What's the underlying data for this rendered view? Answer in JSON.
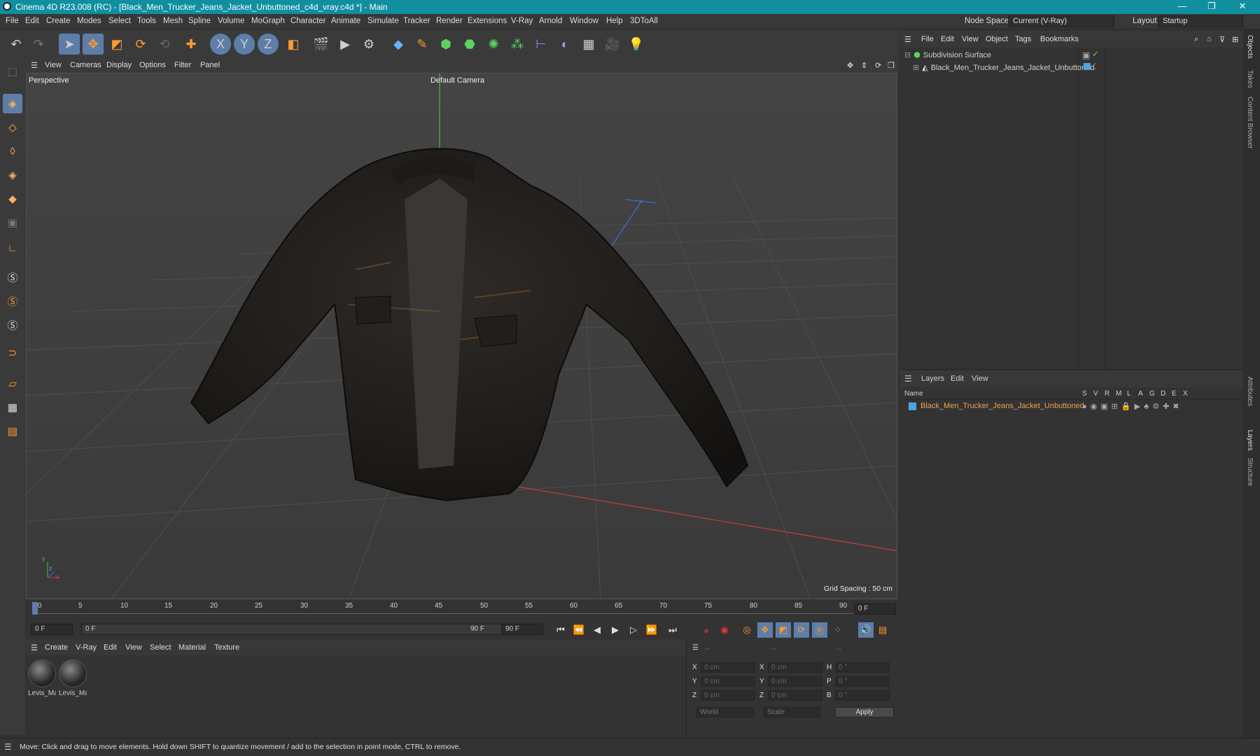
{
  "window": {
    "title": "Cinema 4D R23.008 (RC) - [Black_Men_Trucker_Jeans_Jacket_Unbuttoned_c4d_vray.c4d *] - Main",
    "minimize": "—",
    "restore": "❐",
    "close": "✕"
  },
  "menubar": {
    "items": [
      "File",
      "Edit",
      "Create",
      "Modes",
      "Select",
      "Tools",
      "Mesh",
      "Spline",
      "Volume",
      "MoGraph",
      "Character",
      "Animate",
      "Simulate",
      "Tracker",
      "Render",
      "Extensions",
      "V-Ray",
      "Arnold",
      "Window",
      "Help",
      "3DToAll"
    ],
    "node_space_label": "Node Space:",
    "node_space_value": "Current (V-Ray)",
    "layout_label": "Layout:",
    "layout_value": "Startup"
  },
  "toolbar": {
    "icons": [
      "undo-icon",
      "redo-icon",
      "select-cursor-icon",
      "move-icon",
      "scale-icon",
      "rotate-icon",
      "recent-tool-icon",
      "add-icon",
      "x-axis-icon",
      "y-axis-icon",
      "z-axis-icon",
      "coordinate-system-icon",
      "render-region-icon",
      "render-view-icon",
      "render-settings-icon",
      "cube-icon",
      "spline-pen-icon",
      "subdivision-icon",
      "extrude-icon",
      "mograph-cloner-icon",
      "array-icon",
      "deformer-icon",
      "field-icon",
      "floor-icon",
      "camera-icon",
      "light-icon"
    ],
    "axis_x": "X",
    "axis_y": "Y",
    "axis_z": "Z"
  },
  "viewport_menu": {
    "items": [
      "View",
      "Cameras",
      "Display",
      "Options",
      "Filter",
      "Panel"
    ]
  },
  "viewport": {
    "label": "Perspective",
    "camera": "Default Camera",
    "grid_spacing": "Grid Spacing : 50 cm",
    "axis_y": "y",
    "axis_z": "z",
    "axis_x": "x"
  },
  "timeline": {
    "ticks": [
      "0",
      "5",
      "10",
      "15",
      "20",
      "25",
      "30",
      "35",
      "40",
      "45",
      "50",
      "55",
      "60",
      "65",
      "70",
      "75",
      "80",
      "85",
      "90"
    ],
    "current_frame": "0 F"
  },
  "playbar": {
    "start": "0 F",
    "range_start": "0 F",
    "range_end": "90 F",
    "end": "90 F"
  },
  "material_menu": {
    "items": [
      "Create",
      "V-Ray",
      "Edit",
      "View",
      "Select",
      "Material",
      "Texture"
    ]
  },
  "materials": [
    {
      "name": "Levis_Ma"
    },
    {
      "name": "Levis_Ma"
    }
  ],
  "coords": {
    "header": [
      "--",
      "--",
      "--"
    ],
    "rows": [
      {
        "a": "X",
        "av": "0 cm",
        "b": "X",
        "bv": "0 cm",
        "c": "H",
        "cv": "0 °"
      },
      {
        "a": "Y",
        "av": "0 cm",
        "b": "Y",
        "bv": "0 cm",
        "c": "P",
        "cv": "0 °"
      },
      {
        "a": "Z",
        "av": "0 cm",
        "b": "Z",
        "bv": "0 cm",
        "c": "B",
        "cv": "0 °"
      }
    ],
    "mode": "World",
    "mode2": "Scale",
    "apply": "Apply"
  },
  "status": "Move: Click and drag to move elements. Hold down SHIFT to quantize movement / add to the selection in point mode, CTRL to remove.",
  "object_manager": {
    "menu": [
      "File",
      "Edit",
      "View",
      "Object",
      "Tags",
      "Bookmarks"
    ],
    "objects": [
      {
        "name": "Subdivision Surface"
      },
      {
        "name": "Black_Men_Trucker_Jeans_Jacket_Unbuttoned"
      }
    ]
  },
  "layer_manager": {
    "menu": [
      "Layers",
      "Edit",
      "View"
    ],
    "columns": [
      "Name",
      "S",
      "V",
      "R",
      "M",
      "L",
      "A",
      "G",
      "D",
      "E",
      "X"
    ],
    "layers": [
      {
        "name": "Black_Men_Trucker_Jeans_Jacket_Unbuttoned",
        "color": "#4fa3e0"
      }
    ]
  },
  "right_tabs": [
    "Objects",
    "Takes",
    "Content Browser",
    "Attributes",
    "Layers",
    "Structure"
  ],
  "colors": {
    "accent": "#5d7ea8",
    "layer_name": "#f0a050",
    "titlebar": "#0f8fa0"
  }
}
